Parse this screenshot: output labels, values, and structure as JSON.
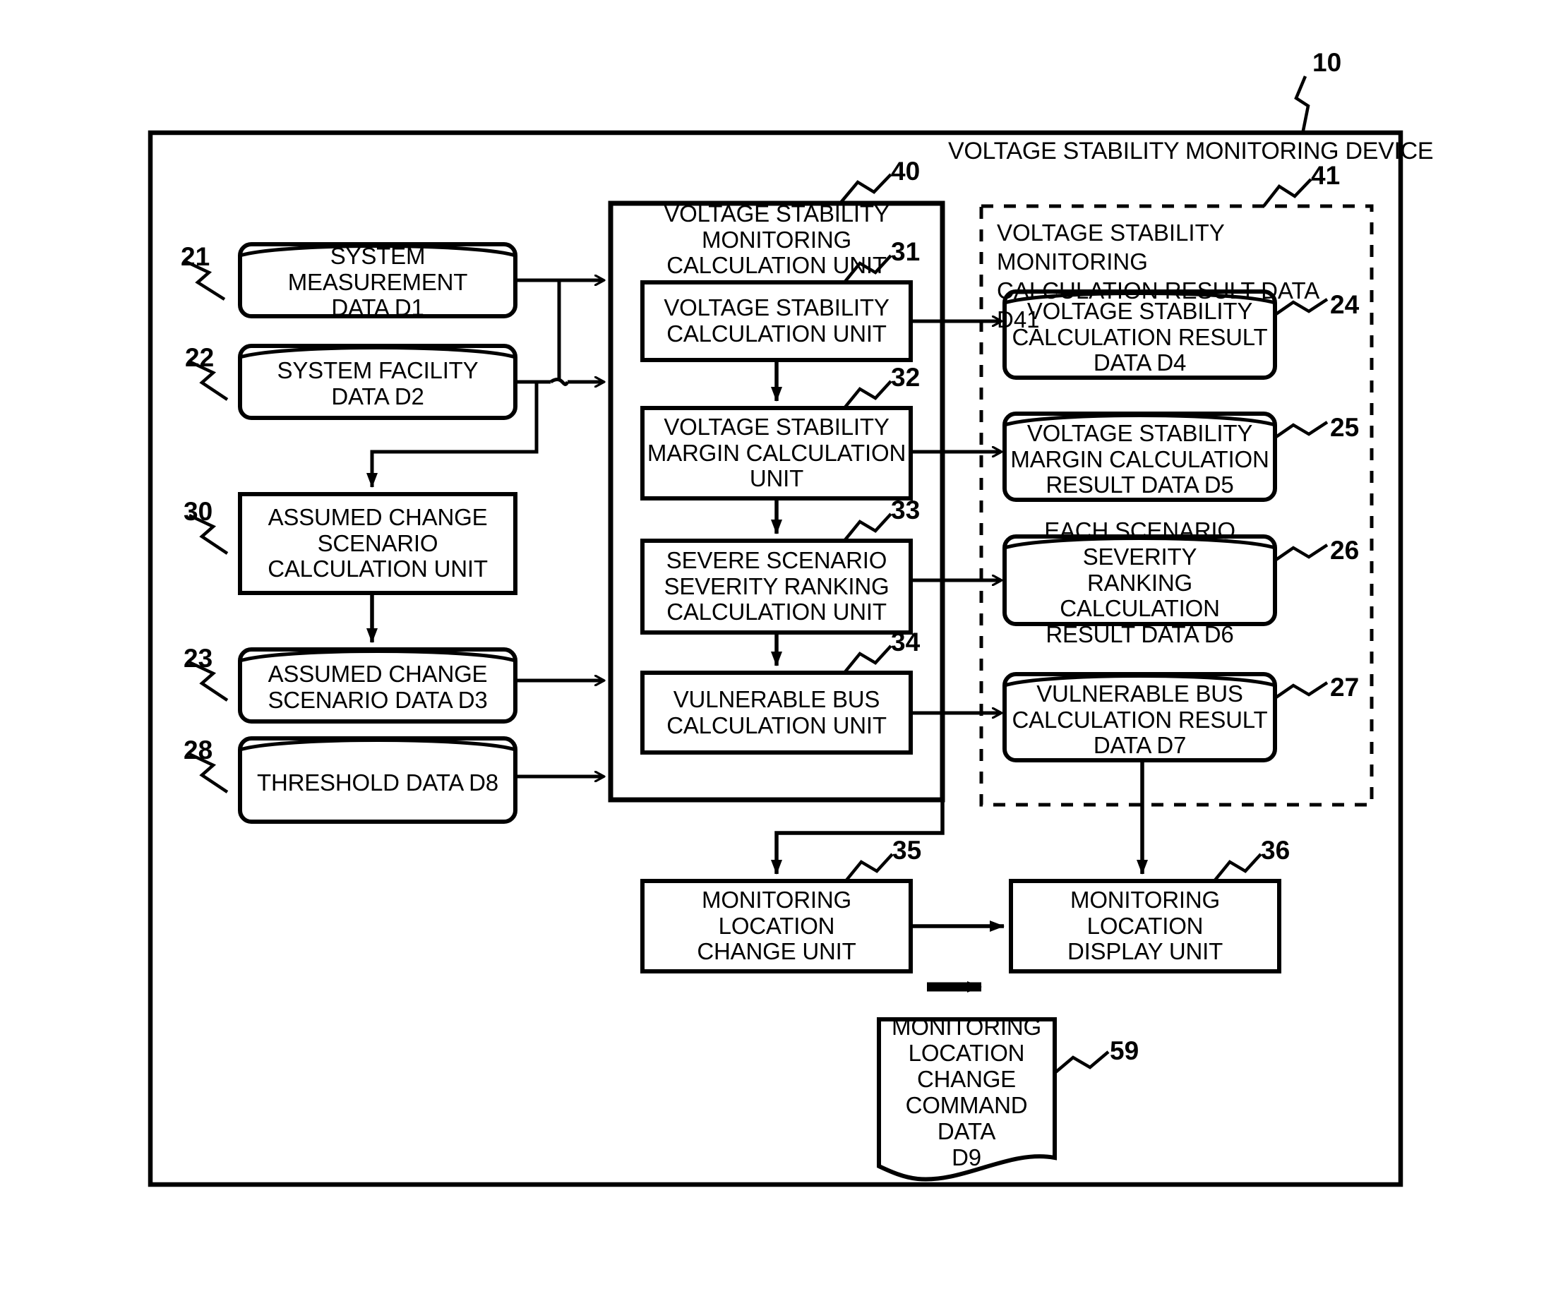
{
  "figure": {
    "device_title": "VOLTAGE STABILITY MONITORING DEVICE",
    "device_ref": "10",
    "calc_unit_title": "VOLTAGE STABILITY MONITORING\nCALCULATION UNIT",
    "calc_unit_ref": "40",
    "result_group_title": "VOLTAGE STABILITY MONITORING\nCALCULATION RESULT DATA D41",
    "result_group_ref": "41"
  },
  "inputs": [
    {
      "ref": "21",
      "label": "SYSTEM MEASUREMENT\nDATA D1"
    },
    {
      "ref": "22",
      "label": "SYSTEM FACILITY\nDATA D2"
    },
    {
      "ref": "30",
      "label": "ASSUMED CHANGE\nSCENARIO\nCALCULATION UNIT"
    },
    {
      "ref": "23",
      "label": "ASSUMED  CHANGE\nSCENARIO  DATA  D3"
    },
    {
      "ref": "28",
      "label": "THRESHOLD  DATA  D8"
    }
  ],
  "calc_units": [
    {
      "ref": "31",
      "label": "VOLTAGE  STABILITY\nCALCULATION  UNIT"
    },
    {
      "ref": "32",
      "label": "VOLTAGE STABILITY\nMARGIN CALCULATION\nUNIT"
    },
    {
      "ref": "33",
      "label": "SEVERE SCENARIO\nSEVERITY RANKING\nCALCULATION UNIT"
    },
    {
      "ref": "34",
      "label": "VULNERABLE BUS\nCALCULATION UNIT"
    }
  ],
  "results": [
    {
      "ref": "24",
      "label": "VOLTAGE STABILITY\nCALCULATION RESULT\nDATA D4"
    },
    {
      "ref": "25",
      "label": "VOLTAGE STABILITY\nMARGIN CALCULATION\nRESULT DATA D5"
    },
    {
      "ref": "26",
      "label": "EACH SCENARIO SEVERITY\nRANKING CALCULATION\nRESULT DATA D6"
    },
    {
      "ref": "27",
      "label": "VULNERABLE BUS\nCALCULATION RESULT\nDATA D7"
    }
  ],
  "outputs": [
    {
      "ref": "35",
      "label": "MONITORING LOCATION\nCHANGE UNIT"
    },
    {
      "ref": "36",
      "label": "MONITORING LOCATION\nDISPLAY UNIT"
    }
  ],
  "document": {
    "ref": "59",
    "label": "MONITORING\nLOCATION\nCHANGE\nCOMMAND DATA\nD9"
  },
  "colors": {
    "ink": "#000000",
    "paper": "#ffffff"
  }
}
